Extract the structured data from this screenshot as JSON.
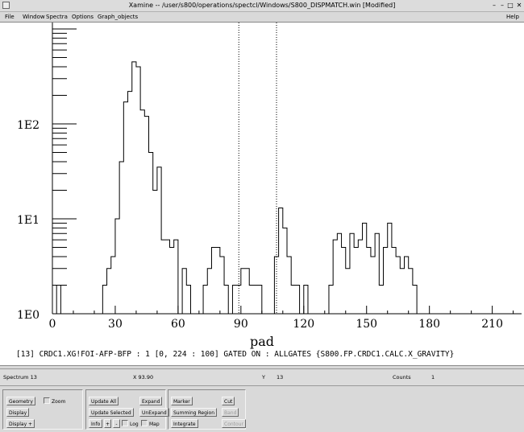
{
  "window": {
    "title": "Xamine -- /user/s800/operations/spectcl/Windows/S800_DISPMATCH.win [Modified]",
    "controls": [
      "–",
      "–",
      "□",
      "✕"
    ]
  },
  "menubar": {
    "items": [
      "File",
      "Window",
      "Spectra",
      "Options",
      "Graph_objects"
    ],
    "help": "Help"
  },
  "plot": {
    "caption": "[13] CRDC1.XG!FOI-AFP-BFP : 1 [0, 224 : 100] GATED ON : ALLGATES {S800.FP.CRDC1.CALC.X_GRAVITY}"
  },
  "chart_data": {
    "type": "line",
    "style": "step histogram",
    "xlabel": "pad",
    "ylabel": "",
    "yscale": "log",
    "xlim": [
      0,
      224
    ],
    "ylim": [
      1,
      1000
    ],
    "x_ticks": [
      0,
      30,
      60,
      90,
      120,
      150,
      180,
      210
    ],
    "y_tick_labels": [
      "1E0",
      "1E1",
      "1E2"
    ],
    "y_tick_values": [
      1,
      10,
      100
    ],
    "markers_x": [
      89,
      107
    ],
    "bin_width": 2,
    "bins_start": 0,
    "counts": [
      0,
      2,
      1,
      0,
      0,
      0,
      0,
      0,
      0,
      0,
      0,
      0,
      2,
      3,
      4,
      10,
      40,
      170,
      220,
      450,
      400,
      140,
      120,
      50,
      20,
      35,
      6,
      6,
      5,
      6,
      1,
      3,
      2,
      1,
      0,
      1,
      2,
      3,
      5,
      5,
      4,
      2,
      1,
      2,
      2,
      3,
      3,
      2,
      2,
      2,
      1,
      1,
      1,
      4,
      13,
      8,
      4,
      2,
      2,
      1,
      2,
      1,
      1,
      0,
      1,
      1,
      2,
      6,
      7,
      5,
      3,
      7,
      5,
      6,
      9,
      5,
      4,
      7,
      2,
      5,
      9,
      5,
      4,
      3,
      4,
      3,
      2,
      1,
      1,
      0,
      0,
      0,
      0,
      0,
      0,
      0,
      0,
      0,
      0,
      0,
      0,
      0,
      0,
      0,
      0,
      0,
      0,
      0,
      0,
      0,
      0,
      0
    ]
  },
  "status": {
    "spectrum": "Spectrum  13",
    "x": "X 93.90",
    "y": "Y",
    "y_value": "13",
    "counts_label": "Counts",
    "counts_value": "1"
  },
  "controls": {
    "geometry": "Geometry",
    "display": "Display",
    "display_plus": "Display +",
    "zoom": "Zoom",
    "update_all": "Update All",
    "update_selected": "Update Selected",
    "info": "Info",
    "plus": "+",
    "minus": "-",
    "log": "Log",
    "map": "Map",
    "expand": "Expand",
    "unexpand": "UnExpand",
    "marker": "Marker",
    "summing_region": "Summing Region",
    "integrate": "Integrate",
    "cut": "Cut",
    "band": "Band",
    "contour": "Contour"
  }
}
